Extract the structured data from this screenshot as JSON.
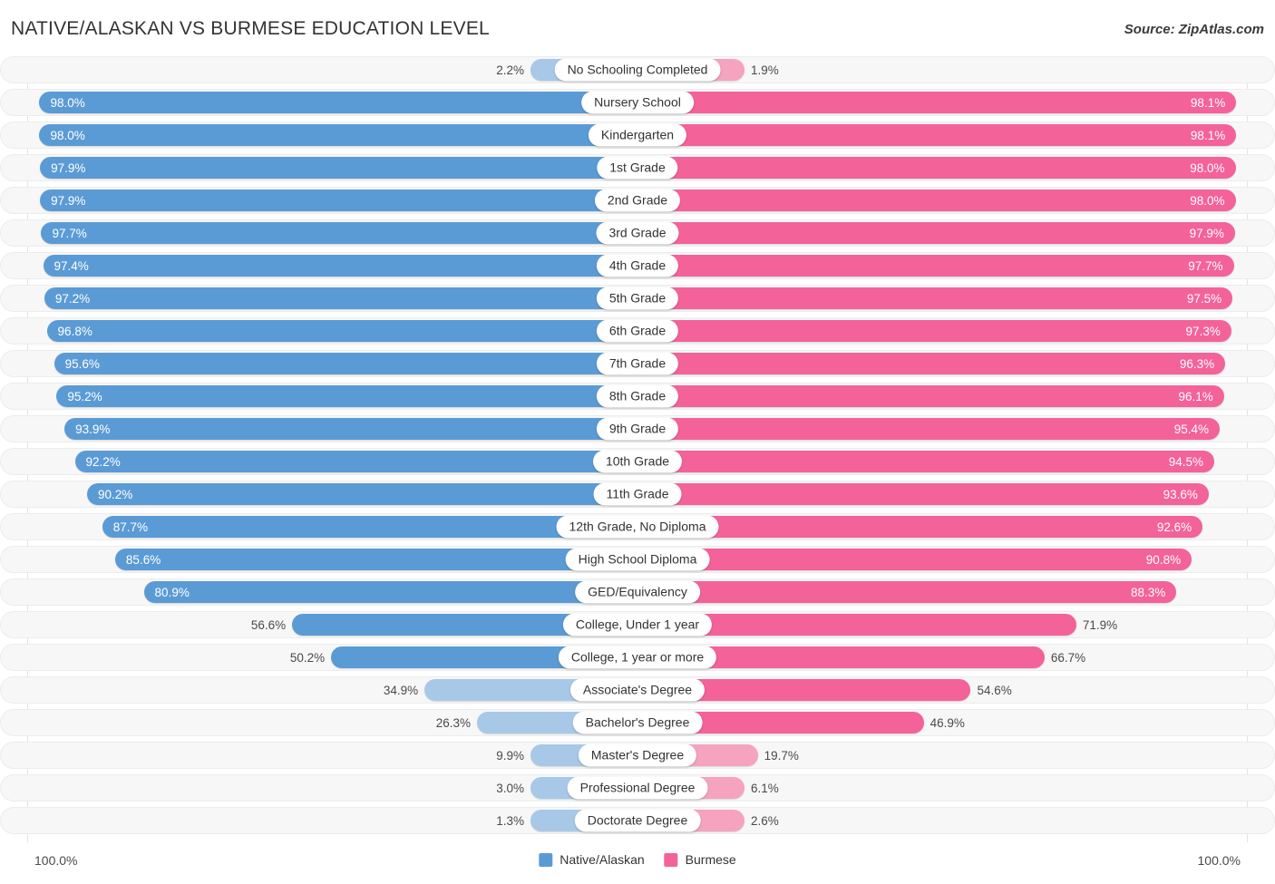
{
  "header": {
    "title": "NATIVE/ALASKAN VS BURMESE EDUCATION LEVEL",
    "source": "Source: ZipAtlas.com"
  },
  "footer": {
    "axis_left": "100.0%",
    "axis_right": "100.0%",
    "legend": [
      {
        "label": "Native/Alaskan",
        "color": "#5b9bd5"
      },
      {
        "label": "Burmese",
        "color": "#f4629a"
      }
    ]
  },
  "colors": {
    "blue_strong": "#5b9bd5",
    "blue_light": "#a8c8e8",
    "pink_strong": "#f4629a",
    "pink_light": "#f5a3bf",
    "track": "#f7f7f7",
    "track_border": "#ececec",
    "gridline": "#e3e3e3",
    "text_dark": "#333333",
    "text_value_outside": "#4a4a4a",
    "text_value_inside": "#ffffff"
  },
  "chart_data": {
    "type": "bar",
    "subtype": "diverging-paired-bar",
    "title": "NATIVE/ALASKAN VS BURMESE EDUCATION LEVEL",
    "xlabel": "",
    "ylabel": "",
    "xlim": [
      0,
      100
    ],
    "axis_unit": "percent",
    "grid": false,
    "legend_position": "bottom-center",
    "categories": [
      "No Schooling Completed",
      "Nursery School",
      "Kindergarten",
      "1st Grade",
      "2nd Grade",
      "3rd Grade",
      "4th Grade",
      "5th Grade",
      "6th Grade",
      "7th Grade",
      "8th Grade",
      "9th Grade",
      "10th Grade",
      "11th Grade",
      "12th Grade, No Diploma",
      "High School Diploma",
      "GED/Equivalency",
      "College, Under 1 year",
      "College, 1 year or more",
      "Associate's Degree",
      "Bachelor's Degree",
      "Master's Degree",
      "Professional Degree",
      "Doctorate Degree"
    ],
    "series": [
      {
        "name": "Native/Alaskan",
        "color": "#5b9bd5",
        "side": "left",
        "values": [
          2.2,
          98.0,
          98.0,
          97.9,
          97.9,
          97.7,
          97.4,
          97.2,
          96.8,
          95.6,
          95.2,
          93.9,
          92.2,
          90.2,
          87.7,
          85.6,
          80.9,
          56.6,
          50.2,
          34.9,
          26.3,
          9.9,
          3.0,
          1.3
        ]
      },
      {
        "name": "Burmese",
        "color": "#f4629a",
        "side": "right",
        "values": [
          1.9,
          98.1,
          98.1,
          98.0,
          98.0,
          97.9,
          97.7,
          97.5,
          97.3,
          96.3,
          96.1,
          95.4,
          94.5,
          93.6,
          92.6,
          90.8,
          88.3,
          71.9,
          66.7,
          54.6,
          46.9,
          19.7,
          6.1,
          2.6
        ]
      }
    ]
  },
  "rows": [
    {
      "label": "No Schooling Completed",
      "left": "2.2%",
      "right": "1.9%",
      "lv": 2.2,
      "rv": 1.9
    },
    {
      "label": "Nursery School",
      "left": "98.0%",
      "right": "98.1%",
      "lv": 98.0,
      "rv": 98.1
    },
    {
      "label": "Kindergarten",
      "left": "98.0%",
      "right": "98.1%",
      "lv": 98.0,
      "rv": 98.1
    },
    {
      "label": "1st Grade",
      "left": "97.9%",
      "right": "98.0%",
      "lv": 97.9,
      "rv": 98.0
    },
    {
      "label": "2nd Grade",
      "left": "97.9%",
      "right": "98.0%",
      "lv": 97.9,
      "rv": 98.0
    },
    {
      "label": "3rd Grade",
      "left": "97.7%",
      "right": "97.9%",
      "lv": 97.7,
      "rv": 97.9
    },
    {
      "label": "4th Grade",
      "left": "97.4%",
      "right": "97.7%",
      "lv": 97.4,
      "rv": 97.7
    },
    {
      "label": "5th Grade",
      "left": "97.2%",
      "right": "97.5%",
      "lv": 97.2,
      "rv": 97.5
    },
    {
      "label": "6th Grade",
      "left": "96.8%",
      "right": "97.3%",
      "lv": 96.8,
      "rv": 97.3
    },
    {
      "label": "7th Grade",
      "left": "95.6%",
      "right": "96.3%",
      "lv": 95.6,
      "rv": 96.3
    },
    {
      "label": "8th Grade",
      "left": "95.2%",
      "right": "96.1%",
      "lv": 95.2,
      "rv": 96.1
    },
    {
      "label": "9th Grade",
      "left": "93.9%",
      "right": "95.4%",
      "lv": 93.9,
      "rv": 95.4
    },
    {
      "label": "10th Grade",
      "left": "92.2%",
      "right": "94.5%",
      "lv": 92.2,
      "rv": 94.5
    },
    {
      "label": "11th Grade",
      "left": "90.2%",
      "right": "93.6%",
      "lv": 90.2,
      "rv": 93.6
    },
    {
      "label": "12th Grade, No Diploma",
      "left": "87.7%",
      "right": "92.6%",
      "lv": 87.7,
      "rv": 92.6
    },
    {
      "label": "High School Diploma",
      "left": "85.6%",
      "right": "90.8%",
      "lv": 85.6,
      "rv": 90.8
    },
    {
      "label": "GED/Equivalency",
      "left": "80.9%",
      "right": "88.3%",
      "lv": 80.9,
      "rv": 88.3
    },
    {
      "label": "College, Under 1 year",
      "left": "56.6%",
      "right": "71.9%",
      "lv": 56.6,
      "rv": 71.9
    },
    {
      "label": "College, 1 year or more",
      "left": "50.2%",
      "right": "66.7%",
      "lv": 50.2,
      "rv": 66.7
    },
    {
      "label": "Associate's Degree",
      "left": "34.9%",
      "right": "54.6%",
      "lv": 34.9,
      "rv": 54.6
    },
    {
      "label": "Bachelor's Degree",
      "left": "26.3%",
      "right": "46.9%",
      "lv": 26.3,
      "rv": 46.9
    },
    {
      "label": "Master's Degree",
      "left": "9.9%",
      "right": "19.7%",
      "lv": 9.9,
      "rv": 19.7
    },
    {
      "label": "Professional Degree",
      "left": "3.0%",
      "right": "6.1%",
      "lv": 3.0,
      "rv": 6.1
    },
    {
      "label": "Doctorate Degree",
      "left": "1.3%",
      "right": "2.6%",
      "lv": 1.3,
      "rv": 2.6
    }
  ]
}
